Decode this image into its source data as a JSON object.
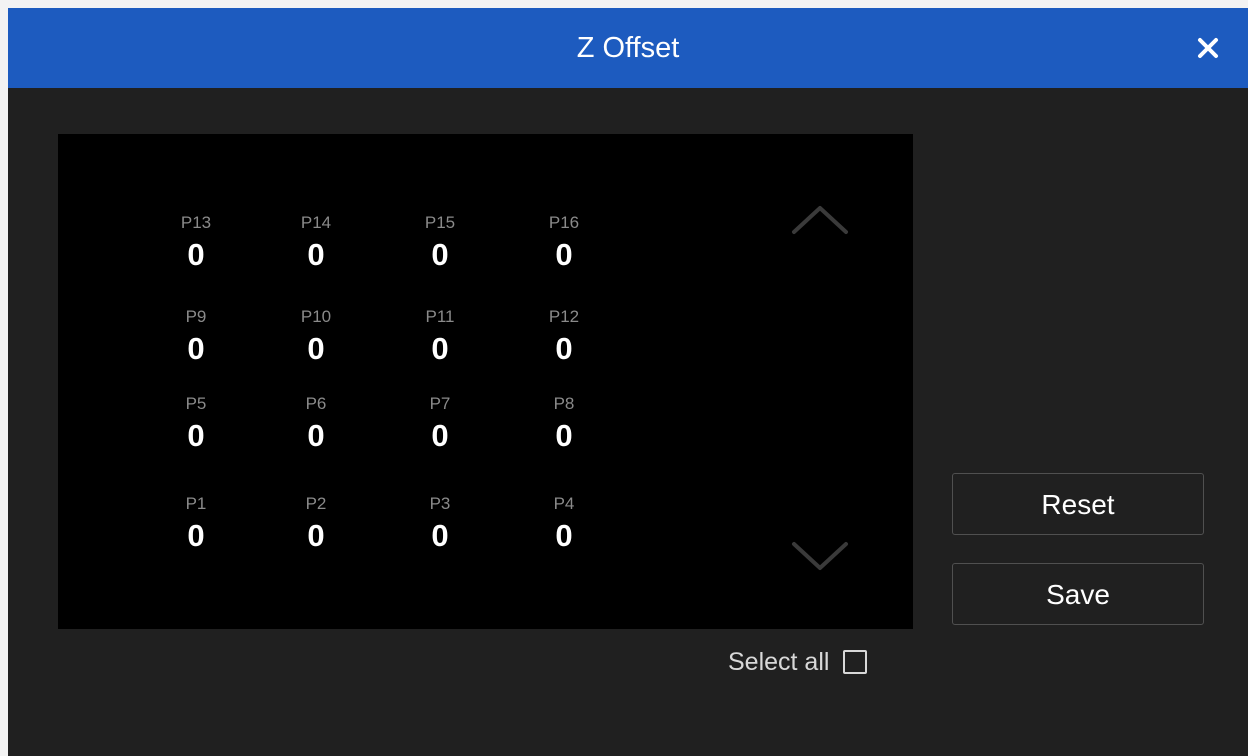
{
  "dialog": {
    "title": "Z Offset",
    "close_icon": "close-icon"
  },
  "grid": {
    "rows": [
      [
        {
          "label": "P13",
          "value": "0"
        },
        {
          "label": "P14",
          "value": "0"
        },
        {
          "label": "P15",
          "value": "0"
        },
        {
          "label": "P16",
          "value": "0"
        }
      ],
      [
        {
          "label": "P9",
          "value": "0"
        },
        {
          "label": "P10",
          "value": "0"
        },
        {
          "label": "P11",
          "value": "0"
        },
        {
          "label": "P12",
          "value": "0"
        }
      ],
      [
        {
          "label": "P5",
          "value": "0"
        },
        {
          "label": "P6",
          "value": "0"
        },
        {
          "label": "P7",
          "value": "0"
        },
        {
          "label": "P8",
          "value": "0"
        }
      ],
      [
        {
          "label": "P1",
          "value": "0"
        },
        {
          "label": "P2",
          "value": "0"
        },
        {
          "label": "P3",
          "value": "0"
        },
        {
          "label": "P4",
          "value": "0"
        }
      ]
    ],
    "up_icon": "chevron-up-icon",
    "down_icon": "chevron-down-icon"
  },
  "actions": {
    "reset_label": "Reset",
    "save_label": "Save"
  },
  "select_all": {
    "label": "Select all",
    "checked": false
  },
  "colors": {
    "titlebar": "#1d5bbf",
    "background": "#202020",
    "panel": "#000000"
  }
}
